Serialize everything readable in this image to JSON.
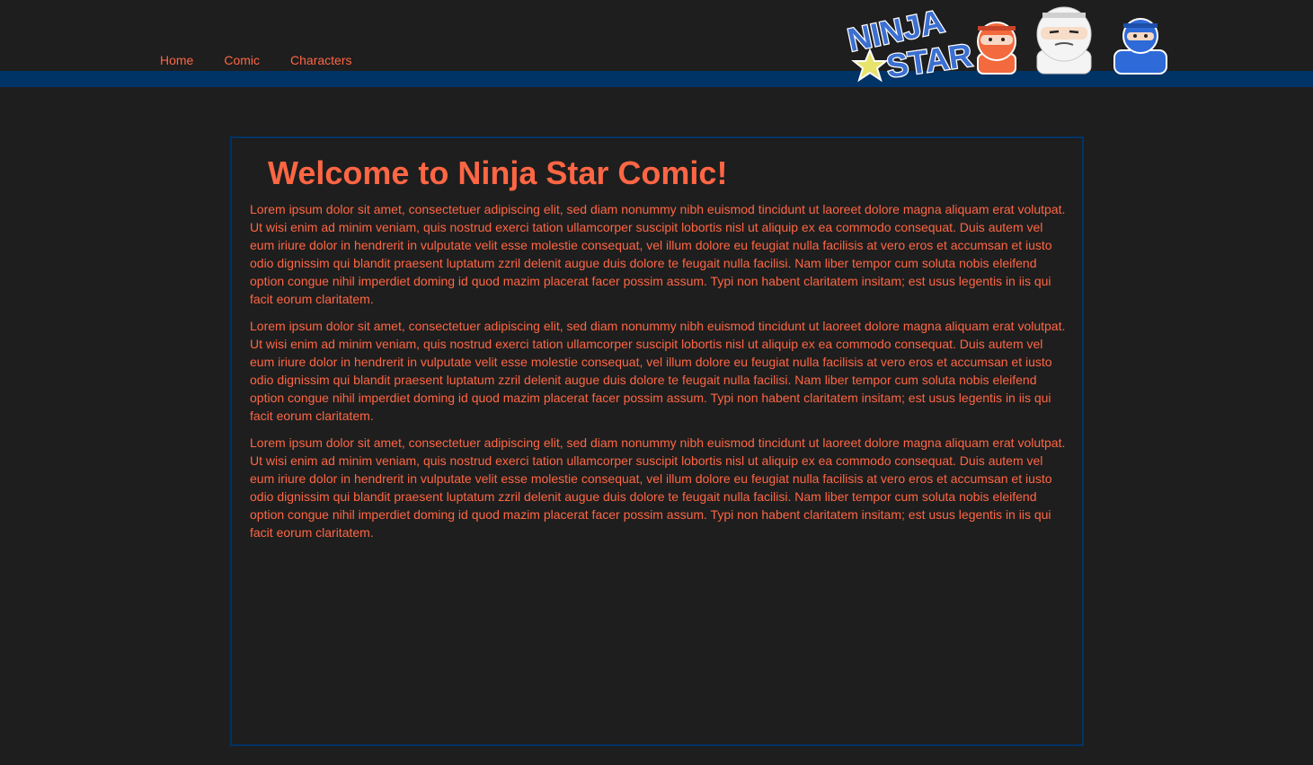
{
  "nav": {
    "items": [
      {
        "label": "Home"
      },
      {
        "label": "Comic"
      },
      {
        "label": "Characters"
      }
    ]
  },
  "logo": {
    "text_line1": "NINJA",
    "text_line2": "STAR",
    "icons": [
      "star-icon",
      "red-ninja-icon",
      "white-ninja-icon",
      "blue-ninja-icon"
    ]
  },
  "main": {
    "title": "Welcome to Ninja Star Comic!",
    "paragraphs": [
      "Lorem ipsum dolor sit amet, consectetuer adipiscing elit, sed diam nonummy nibh euismod tincidunt ut laoreet dolore magna aliquam erat volutpat. Ut wisi enim ad minim veniam, quis nostrud exerci tation ullamcorper suscipit lobortis nisl ut aliquip ex ea commodo consequat. Duis autem vel eum iriure dolor in hendrerit in vulputate velit esse molestie consequat, vel illum dolore eu feugiat nulla facilisis at vero eros et accumsan et iusto odio dignissim qui blandit praesent luptatum zzril delenit augue duis dolore te feugait nulla facilisi. Nam liber tempor cum soluta nobis eleifend option congue nihil imperdiet doming id quod mazim placerat facer possim assum. Typi non habent claritatem insitam; est usus legentis in iis qui facit eorum claritatem.",
      "Lorem ipsum dolor sit amet, consectetuer adipiscing elit, sed diam nonummy nibh euismod tincidunt ut laoreet dolore magna aliquam erat volutpat. Ut wisi enim ad minim veniam, quis nostrud exerci tation ullamcorper suscipit lobortis nisl ut aliquip ex ea commodo consequat. Duis autem vel eum iriure dolor in hendrerit in vulputate velit esse molestie consequat, vel illum dolore eu feugiat nulla facilisis at vero eros et accumsan et iusto odio dignissim qui blandit praesent luptatum zzril delenit augue duis dolore te feugait nulla facilisi. Nam liber tempor cum soluta nobis eleifend option congue nihil imperdiet doming id quod mazim placerat facer possim assum. Typi non habent claritatem insitam; est usus legentis in iis qui facit eorum claritatem.",
      "Lorem ipsum dolor sit amet, consectetuer adipiscing elit, sed diam nonummy nibh euismod tincidunt ut laoreet dolore magna aliquam erat volutpat. Ut wisi enim ad minim veniam, quis nostrud exerci tation ullamcorper suscipit lobortis nisl ut aliquip ex ea commodo consequat. Duis autem vel eum iriure dolor in hendrerit in vulputate velit esse molestie consequat, vel illum dolore eu feugiat nulla facilisis at vero eros et accumsan et iusto odio dignissim qui blandit praesent luptatum zzril delenit augue duis dolore te feugait nulla facilisi. Nam liber tempor cum soluta nobis eleifend option congue nihil imperdiet doming id quod mazim placerat facer possim assum. Typi non habent claritatem insitam; est usus legentis in iis qui facit eorum claritatem."
    ]
  },
  "colors": {
    "background": "#1e1e1e",
    "accent": "#ff6644",
    "bar": "#003366"
  }
}
